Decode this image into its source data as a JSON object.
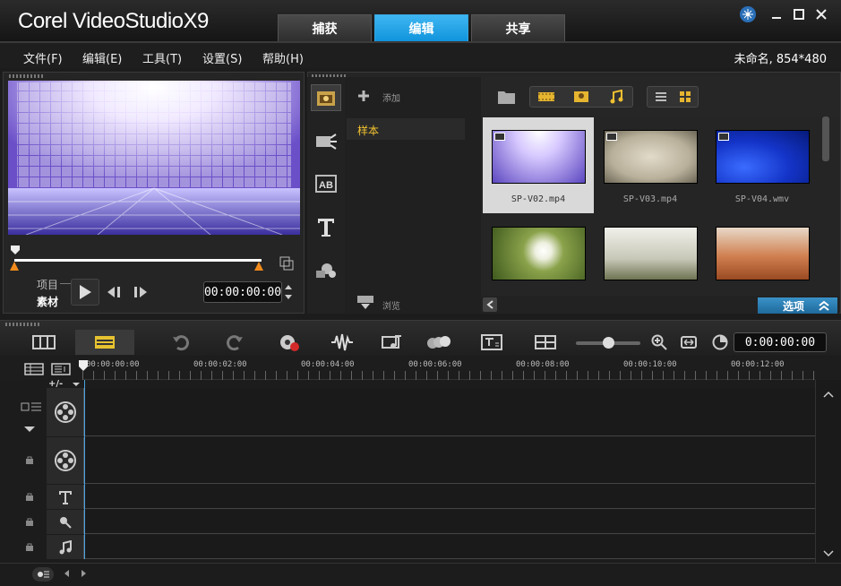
{
  "app": {
    "title": "Corel VideoStudio X9",
    "logo": "Corel VideoStudioX9"
  },
  "tabs": [
    {
      "label": "捕获"
    },
    {
      "label": "编辑",
      "active": true
    },
    {
      "label": "共享"
    }
  ],
  "window_buttons": {
    "help": "help-icon",
    "minimize": "minimize-icon",
    "maximize": "maximize-icon",
    "close": "close-icon"
  },
  "menu": [
    {
      "label": "文件(F)"
    },
    {
      "label": "编辑(E)"
    },
    {
      "label": "工具(T)"
    },
    {
      "label": "设置(S)"
    },
    {
      "label": "帮助(H)"
    }
  ],
  "project_info": "未命名, 854*480",
  "player": {
    "mode_project": "项目",
    "mode_clip": "素材",
    "timecode": "00:00:00:00",
    "scrub_position": 0.0
  },
  "library": {
    "add_label": "添加",
    "folder": "样本",
    "browse_label": "浏览",
    "options_label": "选项",
    "thumbnails": [
      {
        "label": "SP-V02.mp4",
        "selected": true
      },
      {
        "label": "SP-V03.mp4"
      },
      {
        "label": "SP-V04.wmv"
      },
      {
        "label": ""
      },
      {
        "label": ""
      },
      {
        "label": ""
      }
    ]
  },
  "timeline": {
    "timecode": "0:00:00:00",
    "ruler_ticks": [
      "00:00:00:00",
      "00:00:02:00",
      "00:00:04:00",
      "00:00:06:00",
      "00:00:08:00",
      "00:00:10:00",
      "00:00:12:00"
    ],
    "add_remove": "+/-",
    "zoom_level": 0.5
  },
  "colors": {
    "accent": "#1ea3ec",
    "folder_text": "#f4c430",
    "options_bar": "#2a7fb5"
  }
}
